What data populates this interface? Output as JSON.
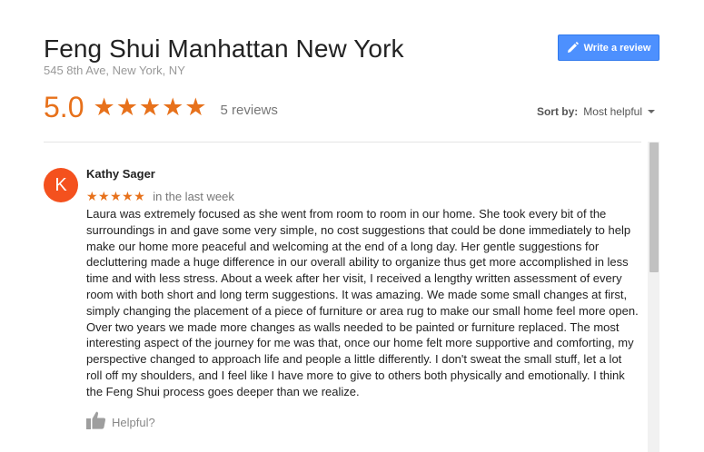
{
  "business": {
    "name": "Feng Shui Manhattan New York",
    "address": "545 8th Ave, New York, NY"
  },
  "actions": {
    "write_review_label": "Write a review",
    "write_review_icon": "pencil-icon"
  },
  "summary": {
    "rating": "5.0",
    "stars": "★★★★★",
    "rating_value": 5,
    "review_count": "5 reviews"
  },
  "sort": {
    "label": "Sort by:",
    "value": "Most helpful"
  },
  "reviews": [
    {
      "avatar_letter": "K",
      "avatar_color": "#f4511e",
      "name": "Kathy Sager",
      "stars": "★★★★★",
      "rating_value": 5,
      "time": "in the last week",
      "text": "Laura was extremely focused as she went  from room to room in our home. She took every bit of the surroundings in and gave some very simple, no cost suggestions that could be done immediately to help make our home more peaceful and welcoming at the end of a long day. Her gentle suggestions for decluttering made a huge difference in our overall ability to organize thus get more accomplished in less time and with less stress. About a week after her visit, I received a lengthy written assessment of every room with both short and long term suggestions. It was amazing. We made some small changes at first, simply changing the placement of a piece of furniture or area rug  to make our small home feel more open. Over two years we made more changes as walls needed to be painted or furniture replaced. The most interesting aspect of the journey for me was that, once our home felt more supportive and comforting, my perspective changed to approach life and people a little differently. I don't sweat the small stuff, let a lot roll off my shoulders, and I feel like I have more to give to others both physically and emotionally. I think the Feng Shui process goes  deeper than we realize.",
      "helpful_label": "Helpful?",
      "helpful_icon": "thumbs-up-icon"
    }
  ],
  "colors": {
    "accent": "#e7711b",
    "button": "#4d90fe",
    "avatar": "#f4511e"
  }
}
